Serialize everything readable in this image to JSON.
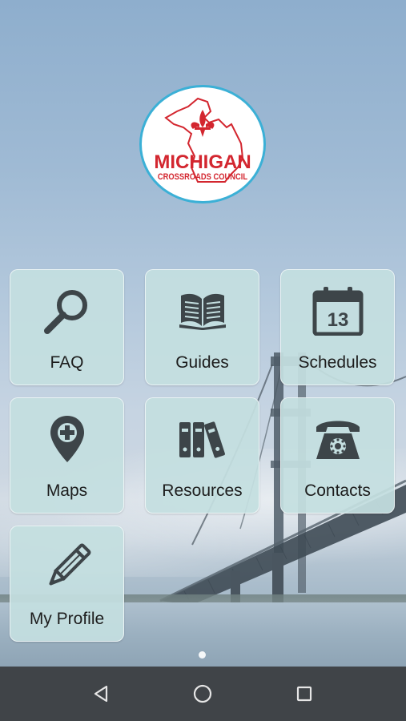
{
  "logo": {
    "main_text": "MICHIGAN",
    "sub_text": "CROSSROADS COUNCIL"
  },
  "tiles": [
    {
      "label": "FAQ",
      "icon": "search-icon"
    },
    {
      "label": "Guides",
      "icon": "book-icon"
    },
    {
      "label": "Schedules",
      "icon": "calendar-icon",
      "calendar_day": "13"
    },
    {
      "label": "Maps",
      "icon": "map-pin-plus-icon"
    },
    {
      "label": "Resources",
      "icon": "binders-icon"
    },
    {
      "label": "Contacts",
      "icon": "telephone-icon"
    },
    {
      "label": "My Profile",
      "icon": "pencil-icon"
    }
  ],
  "colors": {
    "tile_background": "#c4dfe0",
    "icon": "#3d4549",
    "logo_red": "#d3262f",
    "logo_ring": "#3bb0d6",
    "nav_bar": "#404448"
  },
  "pager": {
    "pages": 1,
    "current": 1
  }
}
